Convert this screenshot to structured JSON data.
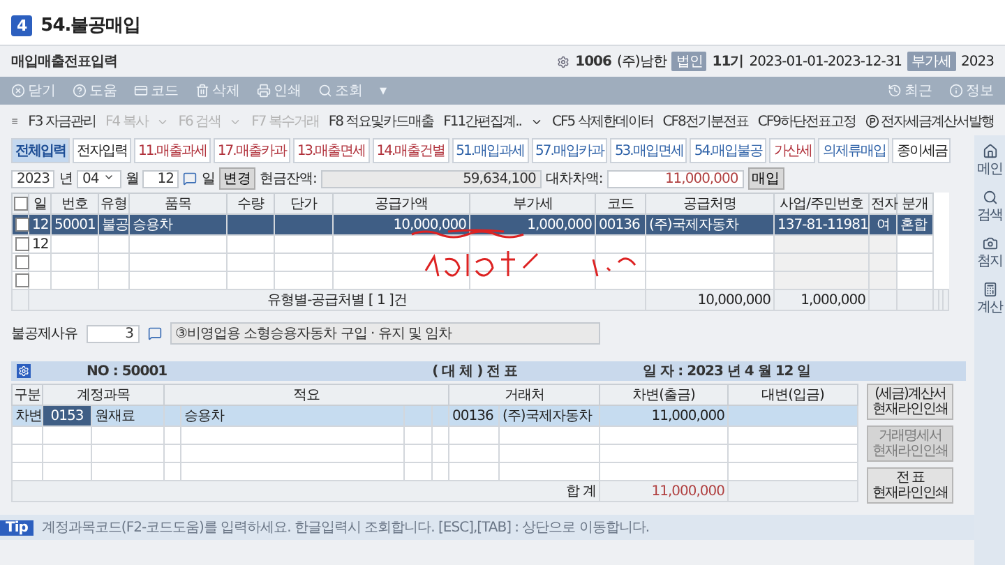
{
  "title": {
    "badge": "4",
    "text": "54.불공매입"
  },
  "window": {
    "title": "매입매출전표입력",
    "company_code": "1006",
    "company": "(주)남한",
    "period_badge": "법인",
    "period": "11기",
    "dates": "2023-01-01-2023-12-31",
    "vat_badge": "부가세",
    "vat_year": "2023"
  },
  "toolbar": [
    {
      "label": "닫기"
    },
    {
      "label": "도움"
    },
    {
      "label": "코드"
    },
    {
      "label": "삭제"
    },
    {
      "label": "인쇄"
    },
    {
      "label": "조회"
    },
    {
      "label": "▾"
    }
  ],
  "toolbar_right": [
    {
      "label": "최근"
    },
    {
      "label": "정보"
    }
  ],
  "function_keys": [
    {
      "label": "F3 자금관리",
      "disabled": false,
      "menu": false
    },
    {
      "label": "F4 복사",
      "disabled": true,
      "menu": true
    },
    {
      "label": "F6 검색",
      "disabled": true,
      "menu": true
    },
    {
      "label": "F7 복수거래",
      "disabled": true,
      "menu": false
    },
    {
      "label": "F8 적요및카드매출",
      "disabled": false,
      "menu": false
    },
    {
      "label": "F11간편집계..",
      "disabled": false,
      "menu": true
    },
    {
      "label": "CF5 삭제한데이터",
      "disabled": false,
      "menu": false
    },
    {
      "label": "CF8전기분전표",
      "disabled": false,
      "menu": false
    },
    {
      "label": "CF9하단전표고정",
      "disabled": false,
      "menu": false
    },
    {
      "label": "전자세금계산서발행",
      "disabled": false,
      "menu": false
    }
  ],
  "tabs": [
    {
      "label": "전체입력",
      "color": "#1f4f96",
      "selected": true
    },
    {
      "label": "전자입력",
      "color": "#222222",
      "selected": false
    },
    {
      "label": "11.매출과세",
      "color": "#b0303a",
      "selected": false
    },
    {
      "label": "17.매출카과",
      "color": "#b0303a",
      "selected": false
    },
    {
      "label": "13.매출면세",
      "color": "#b0303a",
      "selected": false
    },
    {
      "label": "14.매출건별",
      "color": "#b0303a",
      "selected": false
    },
    {
      "label": "51.매입과세",
      "color": "#2f62a8",
      "selected": false
    },
    {
      "label": "57.매입카과",
      "color": "#2f62a8",
      "selected": false
    },
    {
      "label": "53.매입면세",
      "color": "#2f62a8",
      "selected": false
    },
    {
      "label": "54.매입불공",
      "color": "#2f62a8",
      "selected": false
    },
    {
      "label": "가산세",
      "color": "#b0303a",
      "selected": false
    },
    {
      "label": "의제류매입",
      "color": "#2f62a8",
      "selected": false
    },
    {
      "label": "종이세금",
      "color": "#222222",
      "selected": false
    }
  ],
  "date_bar": {
    "year": "2023",
    "year_unit": "년",
    "month": "04",
    "month_unit": "월",
    "day": "12",
    "day_unit": "일",
    "change_button": "변경",
    "cash_label": "현금잔액:",
    "cash": "59,634,100",
    "diff_label": "대차차액:",
    "diff": "11,000,000",
    "type_badge": "매입"
  },
  "table": {
    "header_checked": false,
    "columns": [
      "일",
      "번호",
      "유형",
      "품목",
      "수량",
      "단가",
      "공급가액",
      "부가세",
      "코드",
      "공급처명",
      "사업/주민번호",
      "전자",
      "분개"
    ],
    "rows": [
      {
        "checked": false,
        "selected": true,
        "day": "12",
        "no": "50001",
        "type": "불공",
        "item": "승용차",
        "supply": "10,000,000",
        "vat": "1,000,000",
        "code": "00136",
        "vendor": "(주)국제자동차",
        "reg_no": "137-81-11981",
        "e": "여",
        "journal": "혼합"
      },
      {
        "checked": false,
        "selected": false,
        "day": "12"
      },
      {
        "checked": false,
        "selected": false
      },
      {
        "checked": false,
        "selected": false
      }
    ],
    "summary": {
      "label": "유형별-공급처별 [ 1 ]건",
      "supply": "10,000,000",
      "vat": "1,000,000"
    }
  },
  "reason": {
    "label": "불공제사유",
    "code": "3",
    "text": "③비영업용 소형승용자동차 구입 · 유지 및 임차"
  },
  "voucher": {
    "no": "NO : 50001",
    "title": "( 대 체 ) 전 표",
    "date": "일 자 : 2023 년  4 월 12 일",
    "columns": [
      "구분",
      "계정과목",
      "적요",
      "거래처",
      "차변(출금)",
      "대변(입금)"
    ],
    "rows": [
      {
        "selected": true,
        "side": "차변",
        "account_code": "0153",
        "account": "원재료",
        "memo": "승용차",
        "vendor_code": "00136",
        "vendor": "(주)국제자동차",
        "debit": "11,000,000"
      },
      {
        "selected": false
      },
      {
        "selected": false
      },
      {
        "selected": false
      }
    ],
    "total_label": "합 계",
    "total": "11,000,000",
    "buttons": [
      {
        "lines": [
          "(세금)계산서",
          "현재라인인쇄"
        ],
        "disabled": false
      },
      {
        "lines": [
          "거래명세서",
          "현재라인인쇄"
        ],
        "disabled": true
      },
      {
        "lines": [
          "전 표",
          "현재라인인쇄"
        ],
        "disabled": false
      }
    ]
  },
  "tip": {
    "badge": "Tip",
    "text": "계정과목코드(F2-코드도움)를 입력하세요. 한글입력시 조회합니다. [ESC],[TAB] : 상단으로 이동합니다."
  },
  "sidebar": [
    {
      "label": "메인"
    },
    {
      "label": "검색"
    },
    {
      "label": "첨지"
    },
    {
      "label": "계산"
    }
  ]
}
